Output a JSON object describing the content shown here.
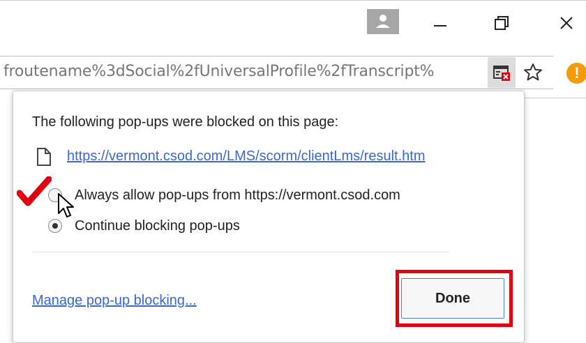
{
  "window": {
    "controls": [
      "minimize-icon",
      "restore-icon",
      "close-icon"
    ]
  },
  "toolbar": {
    "url": "froutename%3dSocial%2fUniversalProfile%2fTranscript%",
    "icons": [
      "popup-blocked-icon",
      "star-icon",
      "alert-icon"
    ],
    "alert_glyph": "!"
  },
  "popup": {
    "title": "The following pop-ups were blocked on this page:",
    "blocked_link": "https://vermont.csod.com/LMS/scorm/clientLms/result.htm",
    "options": [
      {
        "label": "Always allow pop-ups from https://vermont.csod.com",
        "selected": false
      },
      {
        "label": "Continue blocking pop-ups",
        "selected": true
      }
    ],
    "manage_link": "Manage pop-up blocking...",
    "done_label": "Done"
  },
  "colors": {
    "link": "#3b66d6",
    "highlight": "#e3000f",
    "checkmark": "#e3000f",
    "alert": "#f39b0a"
  }
}
